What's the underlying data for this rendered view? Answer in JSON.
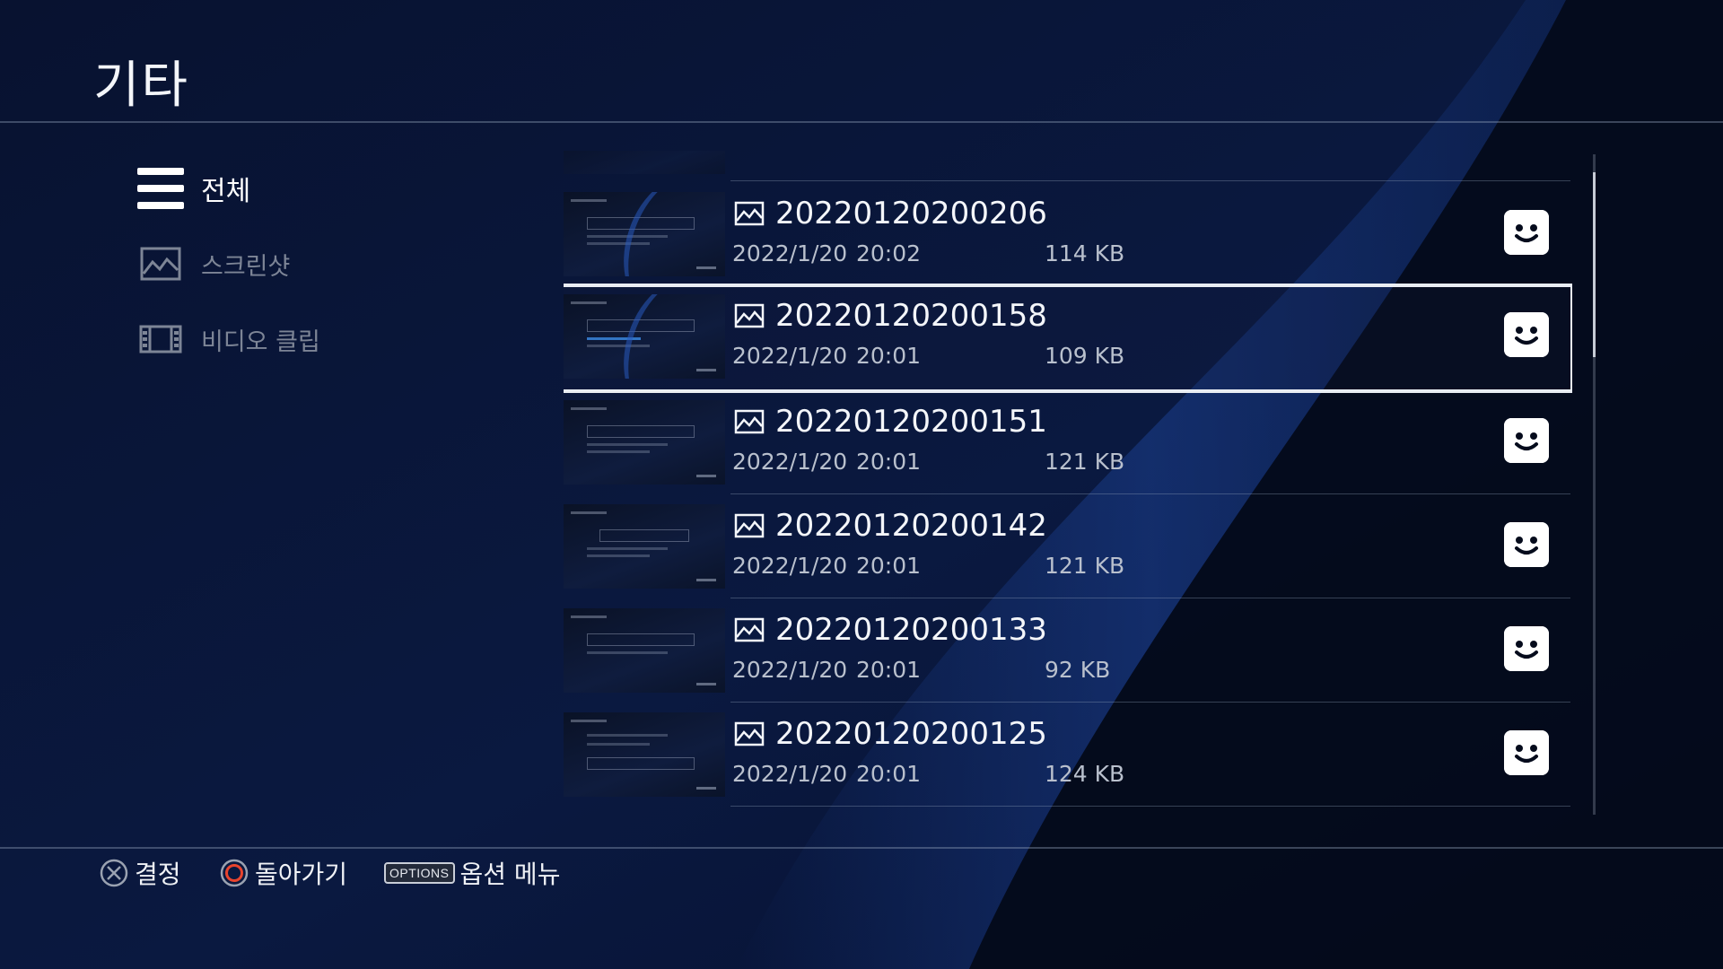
{
  "page": {
    "title": "기타"
  },
  "sidebar": {
    "items": [
      {
        "label": "전체",
        "icon": "hamburger-menu-icon",
        "active": true
      },
      {
        "label": "스크린샷",
        "icon": "screenshot-icon",
        "active": false
      },
      {
        "label": "비디오 클립",
        "icon": "film-strip-icon",
        "active": false
      }
    ]
  },
  "files": [
    {
      "name": "20220120200206",
      "date": "2022/1/20",
      "time": "20:02",
      "size": "114 KB",
      "type_icon": "image-icon",
      "status_icon": "smiley-face-icon"
    },
    {
      "name": "20220120200158",
      "date": "2022/1/20",
      "time": "20:01",
      "size": "109 KB",
      "type_icon": "image-icon",
      "status_icon": "smiley-face-icon",
      "selected": true
    },
    {
      "name": "20220120200151",
      "date": "2022/1/20",
      "time": "20:01",
      "size": "121 KB",
      "type_icon": "image-icon",
      "status_icon": "smiley-face-icon"
    },
    {
      "name": "20220120200142",
      "date": "2022/1/20",
      "time": "20:01",
      "size": "121 KB",
      "type_icon": "image-icon",
      "status_icon": "smiley-face-icon"
    },
    {
      "name": "20220120200133",
      "date": "2022/1/20",
      "time": "20:01",
      "size": "92 KB",
      "type_icon": "image-icon",
      "status_icon": "smiley-face-icon"
    },
    {
      "name": "20220120200125",
      "date": "2022/1/20",
      "time": "20:01",
      "size": "124 KB",
      "type_icon": "image-icon",
      "status_icon": "smiley-face-icon"
    }
  ],
  "footer": {
    "confirm": {
      "button_icon": "cross-button-icon",
      "label": "결정"
    },
    "back": {
      "button_icon": "circle-button-icon",
      "label": "돌아가기"
    },
    "options": {
      "key_label": "OPTIONS",
      "label": "옵션 메뉴"
    }
  },
  "colors": {
    "background": "#050b1c",
    "accent_blue": "#1a3f8f",
    "text_primary": "#f4f6fa",
    "text_secondary": "#b9c0cd",
    "circle_button": "#e8442e"
  }
}
